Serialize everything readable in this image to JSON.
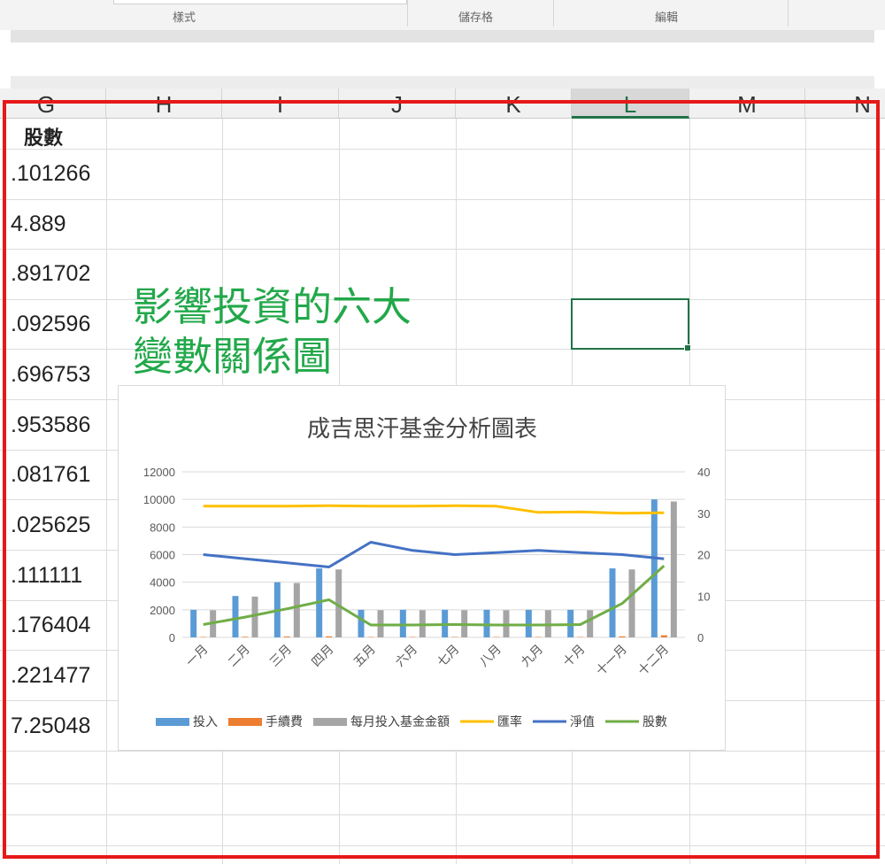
{
  "ribbon": {
    "groups": [
      "樣式",
      "儲存格",
      "編輯"
    ]
  },
  "sheet": {
    "columns": [
      "G",
      "H",
      "I",
      "J",
      "K",
      "L",
      "M",
      "N"
    ],
    "selected_column": "L",
    "column_g": {
      "header": "股數",
      "values": [
        ".101266",
        "4.889",
        ".891702",
        ".092596",
        ".696753",
        ".953586",
        ".081761",
        ".025625",
        ".111111",
        ".176404",
        ".221477",
        "7.25048"
      ]
    },
    "title_lines": [
      "影響投資的六大",
      "變數關係圖"
    ]
  },
  "colors": {
    "accent": "#217346",
    "title_green": "#22a84a",
    "frame": "#e61919"
  },
  "chart_data": {
    "type": "bar",
    "title": "成吉思汗基金分析圖表",
    "categories": [
      "一月",
      "二月",
      "三月",
      "四月",
      "五月",
      "六月",
      "七月",
      "八月",
      "九月",
      "十月",
      "十一月",
      "十二月"
    ],
    "y_left": {
      "ylim": [
        0,
        12000
      ],
      "ticks": [
        "0",
        "2000",
        "4000",
        "6000",
        "8000",
        "10000",
        "12000"
      ]
    },
    "y_right": {
      "ylim": [
        0,
        40
      ],
      "ticks": [
        "0",
        "10",
        "20",
        "30",
        "40"
      ]
    },
    "grid": true,
    "legend_position": "bottom",
    "series": [
      {
        "name": "投入",
        "type": "bar",
        "axis": "left",
        "color": "#5b9bd5",
        "values": [
          2000,
          3000,
          4000,
          5000,
          2000,
          2000,
          2000,
          2000,
          2000,
          2000,
          5000,
          10000
        ]
      },
      {
        "name": "手續費",
        "type": "bar",
        "axis": "left",
        "color": "#ed7d31",
        "values": [
          30,
          45,
          60,
          75,
          30,
          30,
          30,
          30,
          30,
          30,
          75,
          150
        ]
      },
      {
        "name": "每月投入基金金額",
        "type": "bar",
        "axis": "left",
        "color": "#a5a5a5",
        "values": [
          1970,
          2955,
          3940,
          4925,
          1970,
          1970,
          1970,
          1970,
          1970,
          1970,
          4925,
          9850
        ]
      },
      {
        "name": "匯率",
        "type": "line",
        "axis": "right",
        "color": "#ffc000",
        "values": [
          31.7,
          31.7,
          31.7,
          31.8,
          31.7,
          31.7,
          31.8,
          31.7,
          30.2,
          30.3,
          30.0,
          30.1
        ]
      },
      {
        "name": "淨值",
        "type": "line",
        "axis": "right",
        "color": "#4472c4",
        "values": [
          20,
          19,
          18,
          17,
          23,
          21,
          20,
          20.5,
          21,
          20.5,
          20,
          19
        ]
      },
      {
        "name": "股數",
        "type": "line",
        "axis": "right",
        "color": "#70ad47",
        "values": [
          3.1,
          4.9,
          6.9,
          9.1,
          3.0,
          3.0,
          3.1,
          3.0,
          3.0,
          3.1,
          8.2,
          17.3
        ]
      }
    ]
  }
}
